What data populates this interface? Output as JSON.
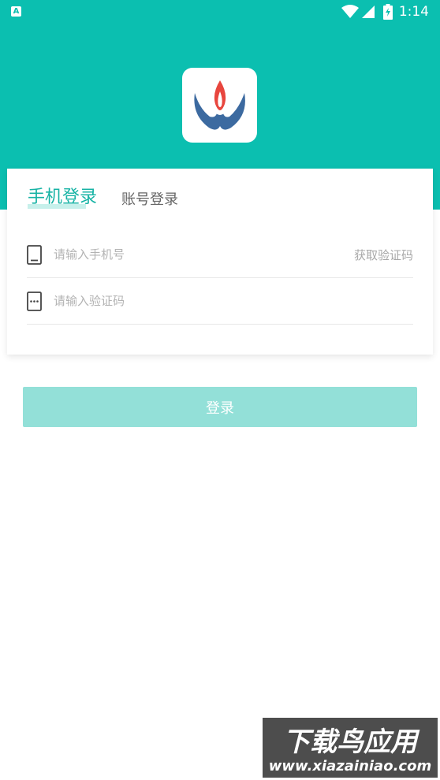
{
  "status_bar": {
    "time": "1:14",
    "notification_icon": "app-notification-icon",
    "icons": [
      "wifi-icon",
      "signal-icon",
      "battery-icon"
    ]
  },
  "app": {
    "logo_icon": "flame-logo-icon"
  },
  "tabs": [
    {
      "label": "手机登录",
      "active": true
    },
    {
      "label": "账号登录",
      "active": false
    }
  ],
  "form": {
    "phone": {
      "placeholder": "请输入手机号",
      "value": "",
      "icon": "phone-icon"
    },
    "code": {
      "placeholder": "请输入验证码",
      "value": "",
      "icon": "sms-code-icon"
    },
    "get_code_label": "获取验证码"
  },
  "login_button_label": "登录",
  "watermark": {
    "title": "下载鸟应用",
    "url": "www.xiazainiao.com"
  },
  "colors": {
    "primary": "#0bbfb0",
    "primary_text": "#17b3a5",
    "button_disabled": "#93e0d8",
    "logo_blue": "#3c6aa0",
    "logo_red": "#e8463e"
  }
}
